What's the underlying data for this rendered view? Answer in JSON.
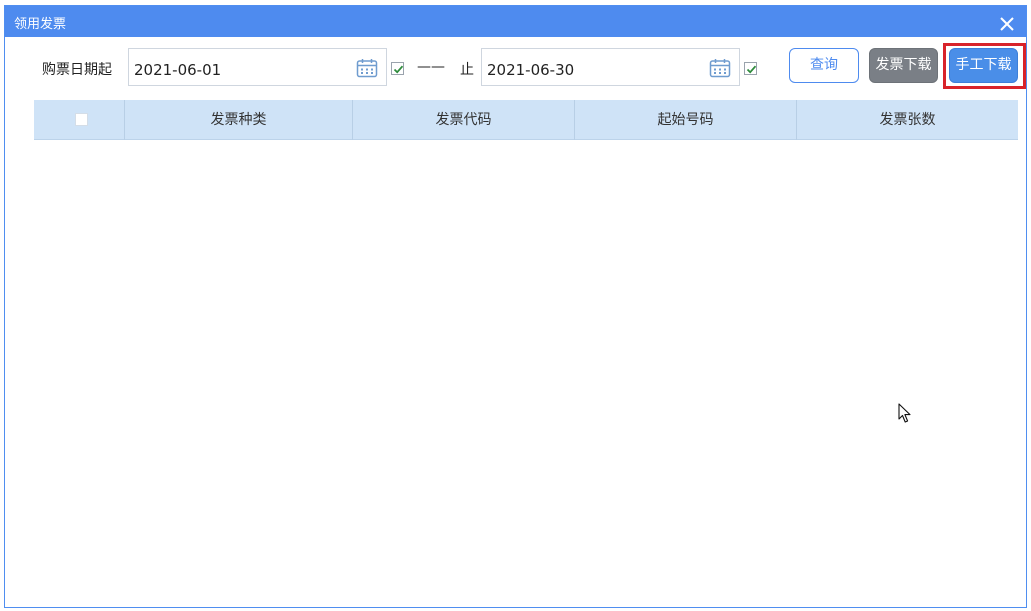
{
  "window": {
    "title": "领用发票"
  },
  "toolbar": {
    "start_label": "购票日期起",
    "start_date": "2021-06-01",
    "start_checked": true,
    "dash": "——",
    "end_label": "止",
    "end_date": "2021-06-30",
    "end_checked": true,
    "query_label": "查询",
    "download_label": "发票下载",
    "manual_download_label": "手工下载"
  },
  "table": {
    "columns": [
      "发票种类",
      "发票代码",
      "起始号码",
      "发票张数"
    ],
    "rows": []
  },
  "colors": {
    "titlebar": "#4e8bef",
    "header_bg": "#cfe3f7",
    "highlight": "#d8232a",
    "manual_button": "#4a8ee8",
    "download_button": "#7a7f86"
  }
}
